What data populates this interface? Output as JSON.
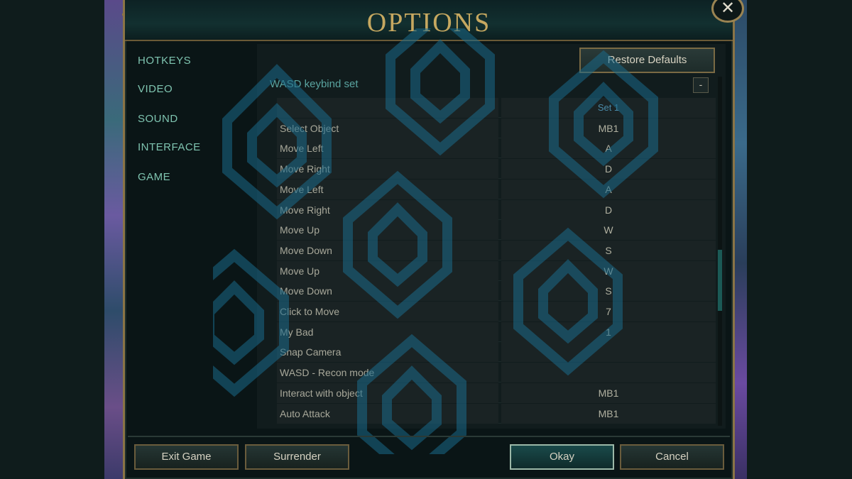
{
  "window": {
    "title": "OPTIONS",
    "close_glyph": "✕"
  },
  "sidebar": {
    "items": [
      {
        "label": "HOTKEYS"
      },
      {
        "label": "VIDEO"
      },
      {
        "label": "SOUND"
      },
      {
        "label": "INTERFACE"
      },
      {
        "label": "GAME"
      }
    ]
  },
  "toolbar": {
    "restore_label": "Restore Defaults"
  },
  "section": {
    "title": "WASD keybind set",
    "collapse_glyph": "-"
  },
  "table": {
    "columns": {
      "action": "",
      "set1": "Set 1"
    },
    "rows": [
      {
        "action": "Select Object",
        "key": "MB1"
      },
      {
        "action": "Move Left",
        "key": "A"
      },
      {
        "action": "Move Right",
        "key": "D"
      },
      {
        "action": "Move Left",
        "key": "A"
      },
      {
        "action": "Move Right",
        "key": "D"
      },
      {
        "action": "Move Up",
        "key": "W"
      },
      {
        "action": "Move Down",
        "key": "S"
      },
      {
        "action": "Move Up",
        "key": "W"
      },
      {
        "action": "Move Down",
        "key": "S"
      },
      {
        "action": "Click to Move",
        "key": "7"
      },
      {
        "action": "My Bad",
        "key": "1"
      },
      {
        "action": "Snap Camera",
        "key": ""
      },
      {
        "action": "WASD - Recon mode",
        "key": ""
      },
      {
        "action": "Interact with object",
        "key": "MB1"
      },
      {
        "action": "Auto Attack",
        "key": "MB1"
      }
    ]
  },
  "footer": {
    "exit_label": "Exit Game",
    "surrender_label": "Surrender",
    "okay_label": "Okay",
    "cancel_label": "Cancel"
  },
  "colors": {
    "accent_gold": "#c6a860",
    "nav_teal": "#7fc4b0",
    "watermark": "#1a6a8a"
  },
  "icons": {
    "close": "close-icon",
    "watermark": "hexagon-watermark-icon"
  }
}
